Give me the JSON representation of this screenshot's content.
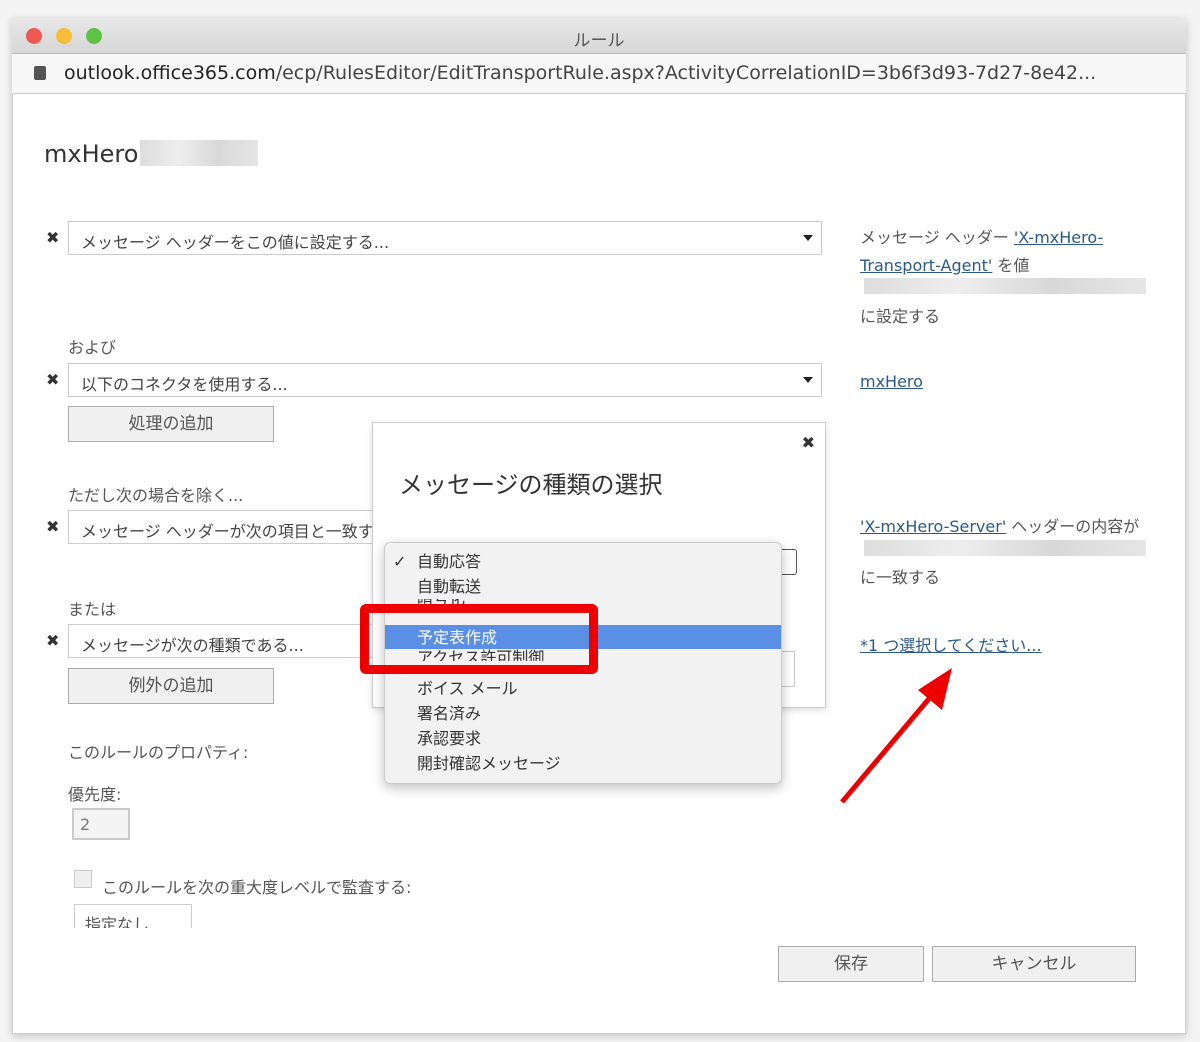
{
  "window": {
    "title": "ルール",
    "url_host": "outlook.office365.com",
    "url_path": "/ecp/RulesEditor/EditTransportRule.aspx?ActivityCorrelationID=3b6f3d93-7d27-8e42..."
  },
  "rule_name": "mxHero",
  "action": {
    "select": "メッセージ ヘッダーをこの値に設定する...",
    "desc_prefix": "メッセージ ヘッダー ",
    "desc_link1": "'X-mxHero-",
    "desc_link2": "Transport-Agent'",
    "desc_mid": " を値",
    "desc_suffix": "に設定する"
  },
  "and_label": "および",
  "connector": {
    "select": "以下のコネクタを使用する...",
    "desc_link": "mxHero"
  },
  "add_action": "処理の追加",
  "except_label": "ただし次の場合を除く...",
  "exception1": {
    "select": "メッセージ ヘッダーが次の項目と一致する...",
    "desc_link": "'X-mxHero-Server'",
    "desc_mid": " ヘッダーの内容が",
    "desc_suffix": "に一致する"
  },
  "or_label": "または",
  "exception2": {
    "select": "メッセージが次の種類である...",
    "desc_link": "*1 つ選択してください..."
  },
  "add_exception": "例外の追加",
  "properties_label": "このルールのプロパティ:",
  "priority_label": "優先度:",
  "priority_value": "2",
  "audit_label": "このルールを次の重大度レベルで監査する:",
  "audit_value": "指定なし",
  "save": "保存",
  "cancel": "キャンセル",
  "dialog": {
    "title": "メッセージの種類の選択"
  },
  "menu": {
    "items": [
      "自動応答",
      "自動転送",
      "暗号化",
      "予定表作成",
      "アクセス許可制御",
      "ボイス メール",
      "署名済み",
      "承認要求",
      "開封確認メッセージ"
    ],
    "checked": "自動応答",
    "selected": "予定表作成"
  },
  "colors": {
    "highlight": "#5b8fe6",
    "annotation": "#e00000",
    "link": "#2a5a8a"
  }
}
